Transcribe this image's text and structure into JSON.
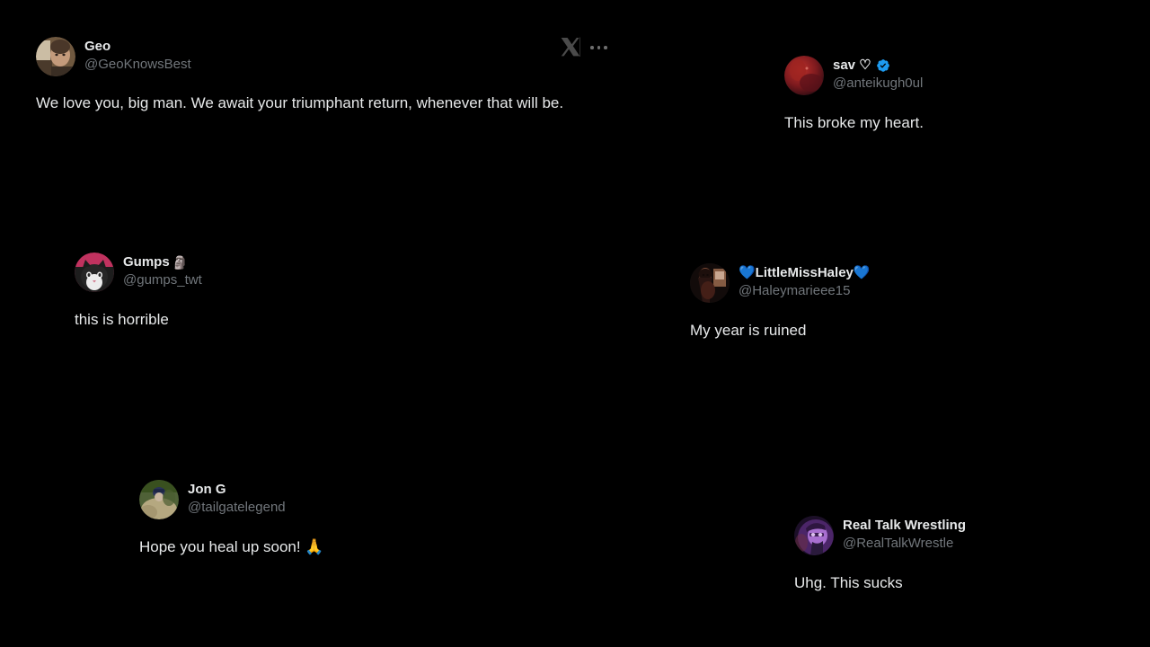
{
  "page": {
    "background_color": "#000000",
    "text_color": "#e7e9ea",
    "muted_text_color": "#71767b",
    "verified_badge_color": "#1d9bf0",
    "logo_color": "#4a4a4a"
  },
  "overlay": {
    "x_logo_name": "x-logo",
    "more_menu_label": "..."
  },
  "tweets": [
    {
      "id": "geo",
      "display_name": "Geo",
      "name_emoji": "",
      "handle": "@GeoKnowsBest",
      "verified": false,
      "text": "We love you, big man. We await your triumphant return, whenever that will be.",
      "avatar_colors": [
        "#8a6b52",
        "#c8b39a",
        "#3b2f26"
      ]
    },
    {
      "id": "sav",
      "display_name": "sav ♡",
      "name_emoji": "",
      "handle": "@anteikugh0ul",
      "verified": true,
      "text": "This broke my heart.",
      "avatar_colors": [
        "#7e1a1d",
        "#b32a26",
        "#2a0c12"
      ]
    },
    {
      "id": "gumps",
      "display_name": "Gumps",
      "name_emoji": "🗿",
      "handle": "@gumps_twt",
      "verified": false,
      "text": "this is horrible",
      "avatar_colors": [
        "#c0325f",
        "#d9d9d9",
        "#1b1b1b"
      ]
    },
    {
      "id": "haley",
      "display_name": "💙LittleMissHaley💙",
      "name_emoji": "",
      "handle": "@Haleymarieee15",
      "verified": false,
      "text": "My year is ruined",
      "avatar_colors": [
        "#6b3026",
        "#d8b9a4",
        "#130b0a"
      ]
    },
    {
      "id": "jong",
      "display_name": "Jon G",
      "name_emoji": "",
      "handle": "@tailgatelegend",
      "verified": false,
      "text": "Hope you heal up soon! 🙏",
      "avatar_colors": [
        "#4d5f35",
        "#b9ab87",
        "#26301c"
      ]
    },
    {
      "id": "rtw",
      "display_name": "Real Talk Wrestling",
      "name_emoji": "",
      "handle": "@RealTalkWrestle",
      "verified": false,
      "text": "Uhg. This sucks",
      "avatar_colors": [
        "#6d3f93",
        "#c08fd8",
        "#1a0f26"
      ]
    }
  ]
}
